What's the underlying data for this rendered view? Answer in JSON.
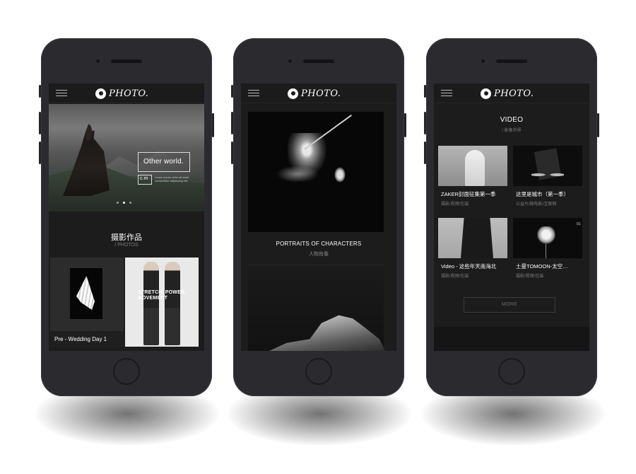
{
  "brand": {
    "logo_text": "PHOTO."
  },
  "phone1": {
    "hero": {
      "headline": "Other world.",
      "badge": "c.m",
      "fine_print": "Lorem ipsum dolor sit amet, consectetur adipiscing elit"
    },
    "section_title": "摄影作品",
    "section_sub": "/ PHOTOS",
    "card_caption": "Pre - Wedding Day 1",
    "poster_text": "STRETCH, POWER, MOVEMENT"
  },
  "phone2": {
    "caption_title": "PORTRAITS OF CHARACTERS",
    "caption_sub": "人物肖像"
  },
  "phone3": {
    "section_title": "VIDEO",
    "section_sub": "/ 影像世界",
    "videos": [
      {
        "title": "ZAKER封面征集第一季",
        "sub": "摄影/视频/包装"
      },
      {
        "title": "这里是城市（第一季）",
        "sub": "公益片/微电影/互联网"
      },
      {
        "title": "Video - 这些年天南海北",
        "sub": "摄影/视频/包装"
      },
      {
        "title": "土曼TOMOON-太空…",
        "sub": "摄影/视频/包装"
      }
    ],
    "thumb4_number": "01",
    "more_label": "MORE"
  },
  "colors": {
    "phone_body": "#2b2b2f",
    "screen_bg": "#1c1c1c",
    "text_primary": "#ffffff",
    "text_muted": "#7a7a7a"
  },
  "icons": [
    "menu-icon",
    "logo-icon",
    "carousel-dots"
  ]
}
